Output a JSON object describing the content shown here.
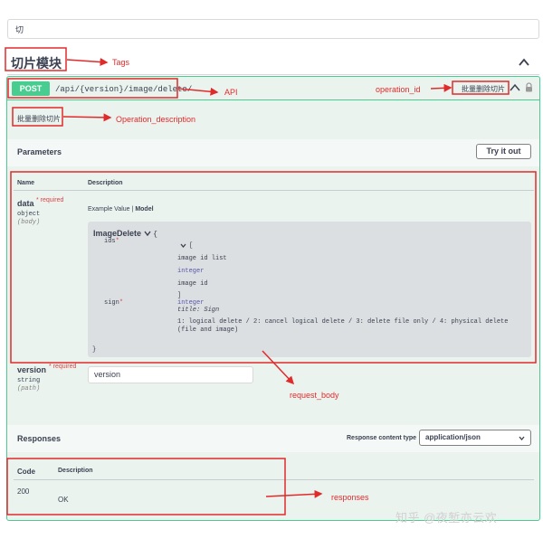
{
  "filter": {
    "value": "切"
  },
  "tag": {
    "title": "切片模块"
  },
  "operation": {
    "method": "POST",
    "path": "/api/{version}/image/delete/",
    "summary": "批量删除切片",
    "description": "批量删除切片"
  },
  "parameters": {
    "title": "Parameters",
    "try_label": "Try it out",
    "col_name": "Name",
    "col_description": "Description",
    "items": [
      {
        "name": "data",
        "required": "* required",
        "type": "object",
        "in": "(body)"
      },
      {
        "name": "version",
        "required": "* required",
        "type": "string",
        "in": "(path)",
        "value": "version"
      }
    ],
    "tabs": {
      "example": "Example Value",
      "sep": "|",
      "model": "Model"
    },
    "model": {
      "name": "ImageDelete",
      "open_brace": "{",
      "close_brace": "}",
      "ids_label": "ids",
      "ids_star": "*",
      "ids_open": "[",
      "ids_desc": "image id list",
      "ids_item_type": "integer",
      "ids_item_desc": "image id",
      "ids_close": "]",
      "sign_label": "sign",
      "sign_star": "*",
      "sign_type": "integer",
      "sign_title": "title: Sign",
      "sign_desc": "1: logical delete / 2: cancel logical delete / 3: delete file only / 4: physical delete (file and image)"
    }
  },
  "responses": {
    "title": "Responses",
    "content_type_label": "Response content type",
    "content_type_value": "application/json",
    "col_code": "Code",
    "col_description": "Description",
    "rows": [
      {
        "code": "200",
        "description": "OK"
      }
    ]
  },
  "annotations": {
    "tags": "Tags",
    "api": "API",
    "operation_id": "operation_id",
    "operation_description": "Operation_description",
    "request_body": "request_body",
    "responses": "responses"
  },
  "watermark": "知乎 @夜堑亦云欢",
  "colors": {
    "post": "#49cc90",
    "annotation": "#e02b2b",
    "required": "#e04343"
  }
}
